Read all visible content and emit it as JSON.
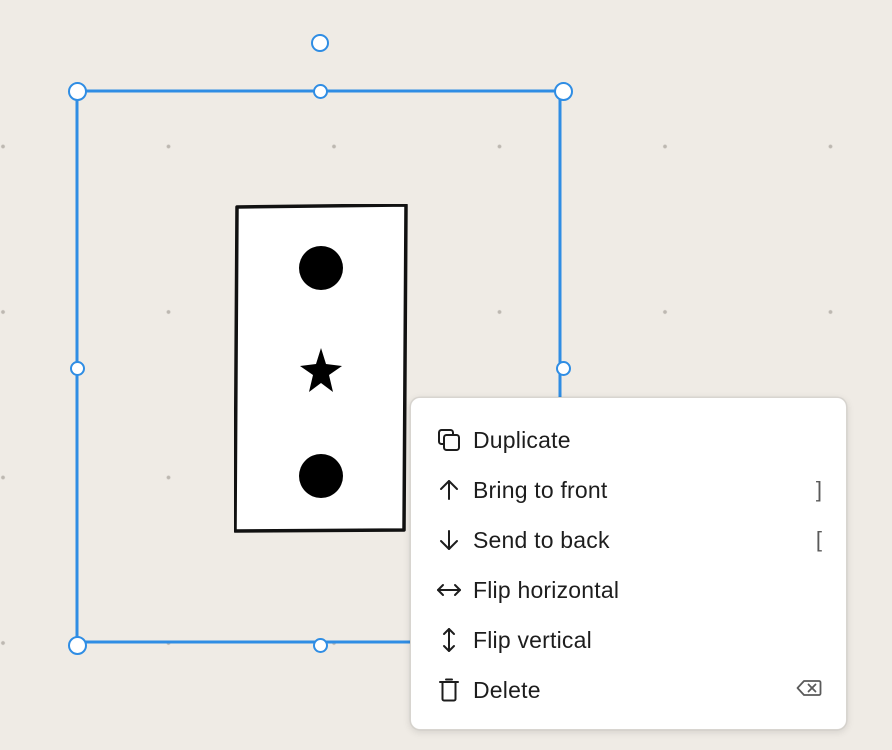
{
  "colors": {
    "canvas_bg": "#efebe5",
    "grid_dot": "#bdb8b1",
    "selection": "#2f8de4",
    "menu_bg": "#ffffff",
    "menu_text": "#1d1d1d",
    "shortcut_text": "#5a5a5a"
  },
  "card": {
    "shapes": [
      "circle",
      "star",
      "circle"
    ]
  },
  "context_menu": {
    "items": [
      {
        "id": "duplicate",
        "label": "Duplicate",
        "icon": "duplicate-icon",
        "shortcut": ""
      },
      {
        "id": "bring-to-front",
        "label": "Bring to front",
        "icon": "arrow-up-icon",
        "shortcut": "]"
      },
      {
        "id": "send-to-back",
        "label": "Send to back",
        "icon": "arrow-down-icon",
        "shortcut": "["
      },
      {
        "id": "flip-horizontal",
        "label": "Flip horizontal",
        "icon": "flip-horizontal-icon",
        "shortcut": ""
      },
      {
        "id": "flip-vertical",
        "label": "Flip vertical",
        "icon": "flip-vertical-icon",
        "shortcut": ""
      },
      {
        "id": "delete",
        "label": "Delete",
        "icon": "trash-icon",
        "shortcut_icon": "backspace-key-icon"
      }
    ]
  }
}
